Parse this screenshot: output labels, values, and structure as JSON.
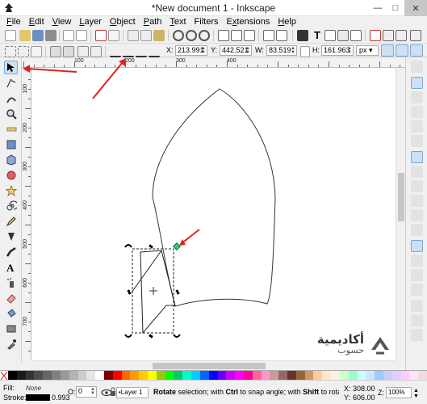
{
  "window": {
    "title": "*New document 1 - Inkscape"
  },
  "menu": [
    {
      "label": "File",
      "key": "F",
      "rest": "ile"
    },
    {
      "label": "Edit",
      "key": "E",
      "rest": "dit"
    },
    {
      "label": "View",
      "key": "V",
      "rest": "iew"
    },
    {
      "label": "Layer",
      "key": "L",
      "rest": "ayer"
    },
    {
      "label": "Object",
      "key": "O",
      "rest": "bject"
    },
    {
      "label": "Path",
      "key": "P",
      "rest": "ath"
    },
    {
      "label": "Text",
      "key": "T",
      "rest": "ext"
    },
    {
      "label": "Filters",
      "key": "",
      "rest": "Filters"
    },
    {
      "label": "Extensions",
      "key": "x",
      "rest": "tensions"
    },
    {
      "label": "Help",
      "key": "H",
      "rest": "elp"
    }
  ],
  "controls": {
    "x_label": "X:",
    "x_value": "213.991",
    "y_label": "Y:",
    "y_value": "442.521",
    "w_label": "W:",
    "w_value": "83.519",
    "h_label": "H:",
    "h_value": "161.963",
    "unit": "px"
  },
  "rulers": {
    "h_labels": [
      "100",
      "200",
      "300",
      "400"
    ],
    "v_labels": [
      "100",
      "200",
      "300",
      "400",
      "500",
      "600",
      "700"
    ]
  },
  "status": {
    "fill_label": "Fill:",
    "fill_value": "None",
    "stroke_label": "Stroke:",
    "stroke_width": "0.993",
    "opacity_label": "O:",
    "opacity_value": "0",
    "layer": "•Layer 1",
    "message_bold1": "Rotate",
    "message_part1": " selection; with ",
    "message_bold2": "Ctrl",
    "message_part2": " to snap angle; with ",
    "message_bold3": "Shift",
    "message_part3": " to rotate around th",
    "cursor_x_label": "X:",
    "cursor_x": "308.00",
    "cursor_y_label": "Y:",
    "cursor_y": "606.00",
    "zoom_label": "Z:",
    "zoom": "100%"
  },
  "watermark": {
    "arabic": "أكاديمية",
    "arabic2": "حسوب"
  },
  "colors": {
    "arrow": "#e02020",
    "accent": "#3c78c8",
    "toolbar_bg": "#f0f0f0"
  },
  "palette": [
    "#000000",
    "#1a1a1a",
    "#333333",
    "#4d4d4d",
    "#666666",
    "#808080",
    "#999999",
    "#b3b3b3",
    "#cccccc",
    "#e6e6e6",
    "#ffffff",
    "#800000",
    "#ff0000",
    "#ff6600",
    "#ff9900",
    "#ffcc00",
    "#ffff00",
    "#99cc00",
    "#00ff00",
    "#00cc66",
    "#00ffcc",
    "#00ccff",
    "#0066ff",
    "#0000ff",
    "#6600ff",
    "#cc00ff",
    "#ff00ff",
    "#ff0099",
    "#ff6699",
    "#ff99cc",
    "#cc9999",
    "#996666",
    "#663333",
    "#996633",
    "#cc9966",
    "#ffcc99",
    "#ffe6cc",
    "#fff0e6",
    "#ccffcc",
    "#99ffcc",
    "#ccffff",
    "#cce6ff",
    "#99ccff",
    "#ccccff",
    "#e6ccff",
    "#ffccff",
    "#ffe6f2",
    "#f2d9e6"
  ]
}
